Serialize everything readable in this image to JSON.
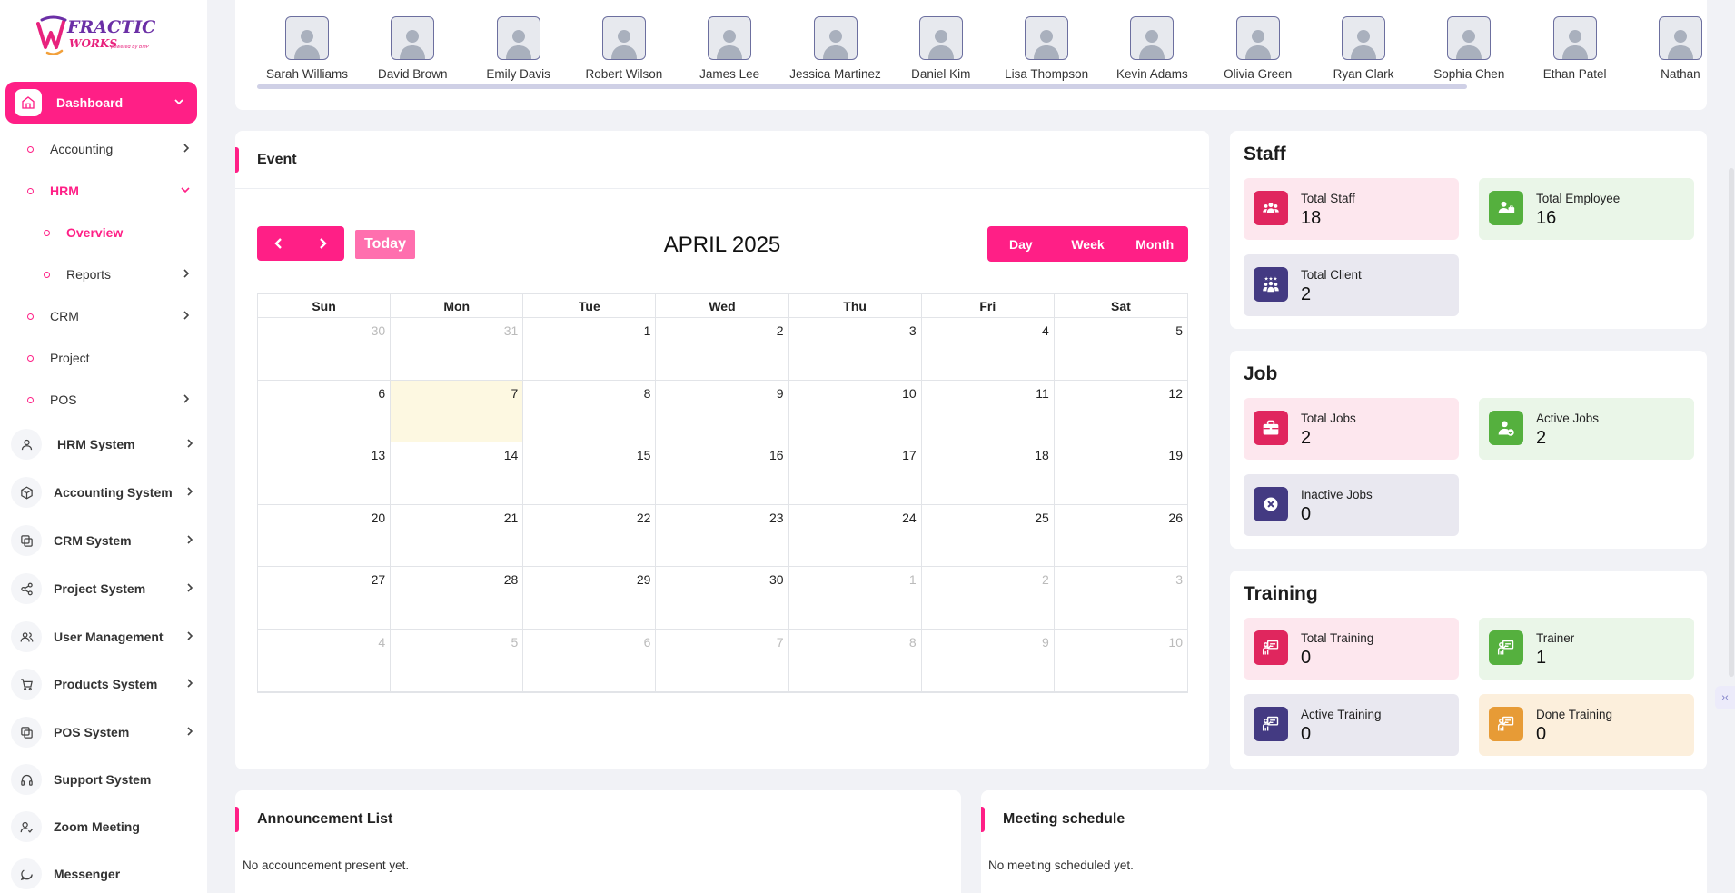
{
  "brand": {
    "logo_text": "FRACTIC WORKS",
    "logo_tagline": "powered by BMP"
  },
  "sidebar": {
    "dashboard": "Dashboard",
    "sub_items": [
      {
        "label": "Accounting",
        "chevron": true
      },
      {
        "label": "HRM",
        "chevron": true,
        "expanded": true
      },
      {
        "label": "Overview",
        "active": true
      },
      {
        "label": "Reports",
        "chevron": true
      },
      {
        "label": "CRM",
        "chevron": true
      },
      {
        "label": "Project",
        "chevron": false
      },
      {
        "label": "POS",
        "chevron": true
      }
    ],
    "systems": [
      {
        "label": "HRM System",
        "icon": "user-icon"
      },
      {
        "label": "Accounting System",
        "icon": "box-icon"
      },
      {
        "label": "CRM System",
        "icon": "layers-icon"
      },
      {
        "label": "Project System",
        "icon": "share-icon"
      },
      {
        "label": "User Management",
        "icon": "users-icon"
      },
      {
        "label": "Products System",
        "icon": "cart-icon"
      },
      {
        "label": "POS System",
        "icon": "layers-icon"
      },
      {
        "label": "Support System",
        "icon": "headphones-icon"
      },
      {
        "label": "Zoom Meeting",
        "icon": "user-check-icon"
      },
      {
        "label": "Messenger",
        "icon": "message-icon"
      }
    ]
  },
  "staff_strip": [
    "Sarah Williams",
    "David Brown",
    "Emily Davis",
    "Robert Wilson",
    "James Lee",
    "Jessica Martinez",
    "Daniel Kim",
    "Lisa Thompson",
    "Kevin Adams",
    "Olivia Green",
    "Ryan Clark",
    "Sophia Chen",
    "Ethan Patel",
    "Nathan"
  ],
  "event": {
    "title": "Event",
    "today_label": "Today",
    "month_title": "APRIL 2025",
    "views": [
      "Day",
      "Week",
      "Month"
    ],
    "weekdays": [
      "Sun",
      "Mon",
      "Tue",
      "Wed",
      "Thu",
      "Fri",
      "Sat"
    ],
    "days": [
      {
        "d": "30",
        "m": true
      },
      {
        "d": "31",
        "m": true
      },
      {
        "d": "1"
      },
      {
        "d": "2"
      },
      {
        "d": "3"
      },
      {
        "d": "4"
      },
      {
        "d": "5"
      },
      {
        "d": "6"
      },
      {
        "d": "7",
        "today": true
      },
      {
        "d": "8"
      },
      {
        "d": "9"
      },
      {
        "d": "10"
      },
      {
        "d": "11"
      },
      {
        "d": "12"
      },
      {
        "d": "13"
      },
      {
        "d": "14"
      },
      {
        "d": "15"
      },
      {
        "d": "16"
      },
      {
        "d": "17"
      },
      {
        "d": "18"
      },
      {
        "d": "19"
      },
      {
        "d": "20"
      },
      {
        "d": "21"
      },
      {
        "d": "22"
      },
      {
        "d": "23"
      },
      {
        "d": "24"
      },
      {
        "d": "25"
      },
      {
        "d": "26"
      },
      {
        "d": "27"
      },
      {
        "d": "28"
      },
      {
        "d": "29"
      },
      {
        "d": "30"
      },
      {
        "d": "1",
        "m": true
      },
      {
        "d": "2",
        "m": true
      },
      {
        "d": "3",
        "m": true
      },
      {
        "d": "4",
        "m": true
      },
      {
        "d": "5",
        "m": true
      },
      {
        "d": "6",
        "m": true
      },
      {
        "d": "7",
        "m": true
      },
      {
        "d": "8",
        "m": true
      },
      {
        "d": "9",
        "m": true
      },
      {
        "d": "10",
        "m": true
      }
    ]
  },
  "staff": {
    "heading": "Staff",
    "total_staff": {
      "label": "Total Staff",
      "value": "18"
    },
    "total_employee": {
      "label": "Total Employee",
      "value": "16"
    },
    "total_client": {
      "label": "Total Client",
      "value": "2"
    }
  },
  "job": {
    "heading": "Job",
    "total_jobs": {
      "label": "Total Jobs",
      "value": "2"
    },
    "active_jobs": {
      "label": "Active Jobs",
      "value": "2"
    },
    "inactive_jobs": {
      "label": "Inactive Jobs",
      "value": "0"
    }
  },
  "training": {
    "heading": "Training",
    "total_training": {
      "label": "Total Training",
      "value": "0"
    },
    "trainer": {
      "label": "Trainer",
      "value": "1"
    },
    "active_training": {
      "label": "Active Training",
      "value": "0"
    },
    "done_training": {
      "label": "Done Training",
      "value": "0"
    }
  },
  "announcement": {
    "title": "Announcement List",
    "empty": "No accouncement present yet."
  },
  "meeting": {
    "title": "Meeting schedule",
    "empty": "No meeting scheduled yet."
  },
  "colors": {
    "accent": "#ff1f86",
    "today_bg": "#fdf8e1"
  }
}
